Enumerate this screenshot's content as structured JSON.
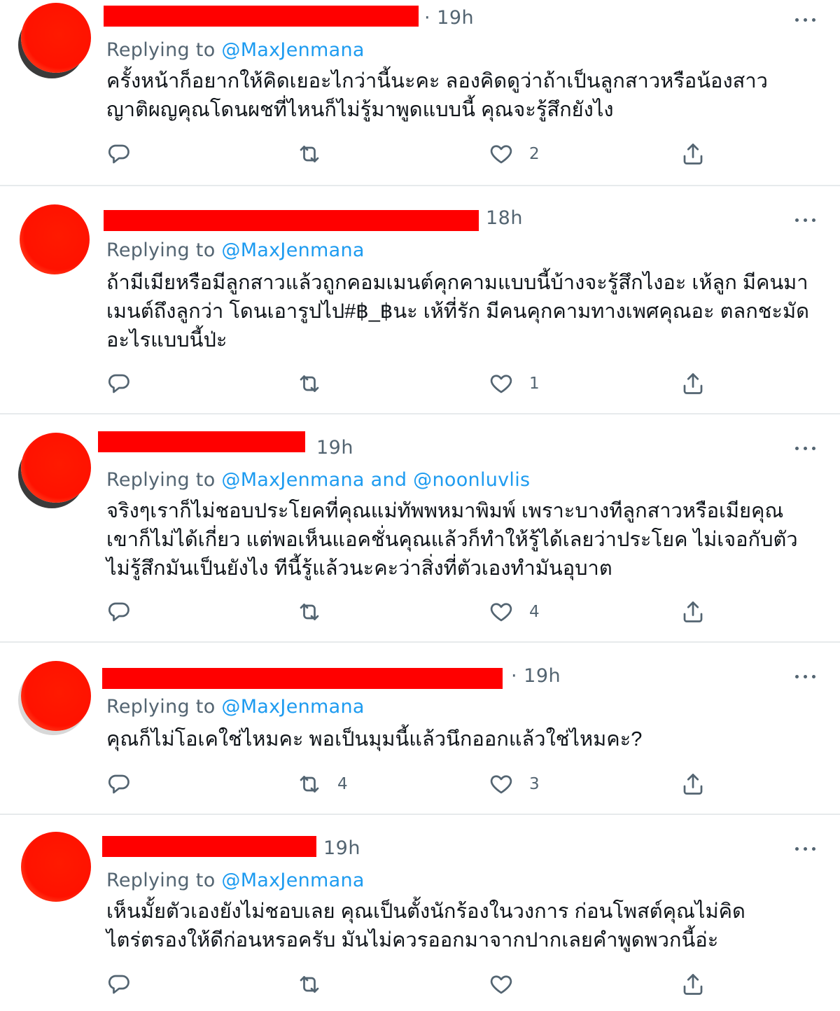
{
  "tweets": [
    {
      "time": "· 19h",
      "replying_prefix": "Replying to ",
      "mentions": "@MaxJenmana",
      "text": "ครั้งหน้าก็อยากให้คิดเยอะไกว่านี้นะคะ ลองคิดดูว่าถ้าเป็นลูกสาวหรือน้องสาว ญาติผญคุณโดนผชที่ไหนก็ไม่รู้มาพูดแบบนี้ คุณจะรู้สึกยังไง",
      "reply_count": "",
      "retweet_count": "",
      "like_count": "2"
    },
    {
      "time": "18h",
      "replying_prefix": "Replying to ",
      "mentions": "@MaxJenmana",
      "text": "ถ้ามีเมียหรือมีลูกสาวแล้วถูกคอมเมนต์คุกคามแบบนี้บ้างจะรู้สึกไงอะ เห้ลูก มีคนมาเมนต์ถึงลูกว่า โดนเอารูปไป#฿_฿นะ เห้ที่รัก มีคนคุกคามทางเพศคุณอะ ตลกชะมัดอะไรแบบนี้ป่ะ",
      "reply_count": "",
      "retweet_count": "",
      "like_count": "1"
    },
    {
      "time": "19h",
      "replying_prefix": "Replying to ",
      "mentions": "@MaxJenmana and @noonluvlis",
      "text": "จริงๆเราก็ไม่ชอบประโยคที่คุณแม่ทัพพหมาพิมพ์ เพราะบางทีลูกสาวหรือเมียคุณเขาก็ไม่ได้เกี่ยว แต่พอเห็นแอคชั่นคุณแล้วก็ทำให้รู้ได้เลยว่าประโยค ไม่เจอกับตัวไม่รู้สึกมันเป็นยังไง  ทีนี้รู้แล้วนะคะว่าสิ่งที่ตัวเองทำมันอุบาต",
      "reply_count": "",
      "retweet_count": "",
      "like_count": "4"
    },
    {
      "time": "· 19h",
      "replying_prefix": "Replying to ",
      "mentions": "@MaxJenmana",
      "text": "คุณก็ไม่โอเคใช่ไหมคะ พอเป็นมุมนี้แล้วนึกออกแล้วใช่ไหมคะ?",
      "reply_count": "",
      "retweet_count": "4",
      "like_count": "3"
    },
    {
      "time": "19h",
      "replying_prefix": "Replying to ",
      "mentions": "@MaxJenmana",
      "text": "เห็นมั้ยตัวเองยังไม่ชอบเลย คุณเป็นตั้งนักร้องในวงการ ก่อนโพสต์คุณไม่คิดไตร่ตรองให้ดีก่อนหรอครับ มันไม่ควรออกมาจากปากเลยคำพูดพวกนี้อ่ะ",
      "reply_count": "",
      "retweet_count": "",
      "like_count": ""
    }
  ],
  "icons": {
    "reply": "reply-icon",
    "retweet": "retweet-icon",
    "like": "heart-icon",
    "share": "share-icon",
    "more": "more-icon"
  },
  "colors": {
    "redaction": "#ff0000",
    "mention": "#1d9bf0",
    "muted": "#536471",
    "text": "#0f1419"
  }
}
